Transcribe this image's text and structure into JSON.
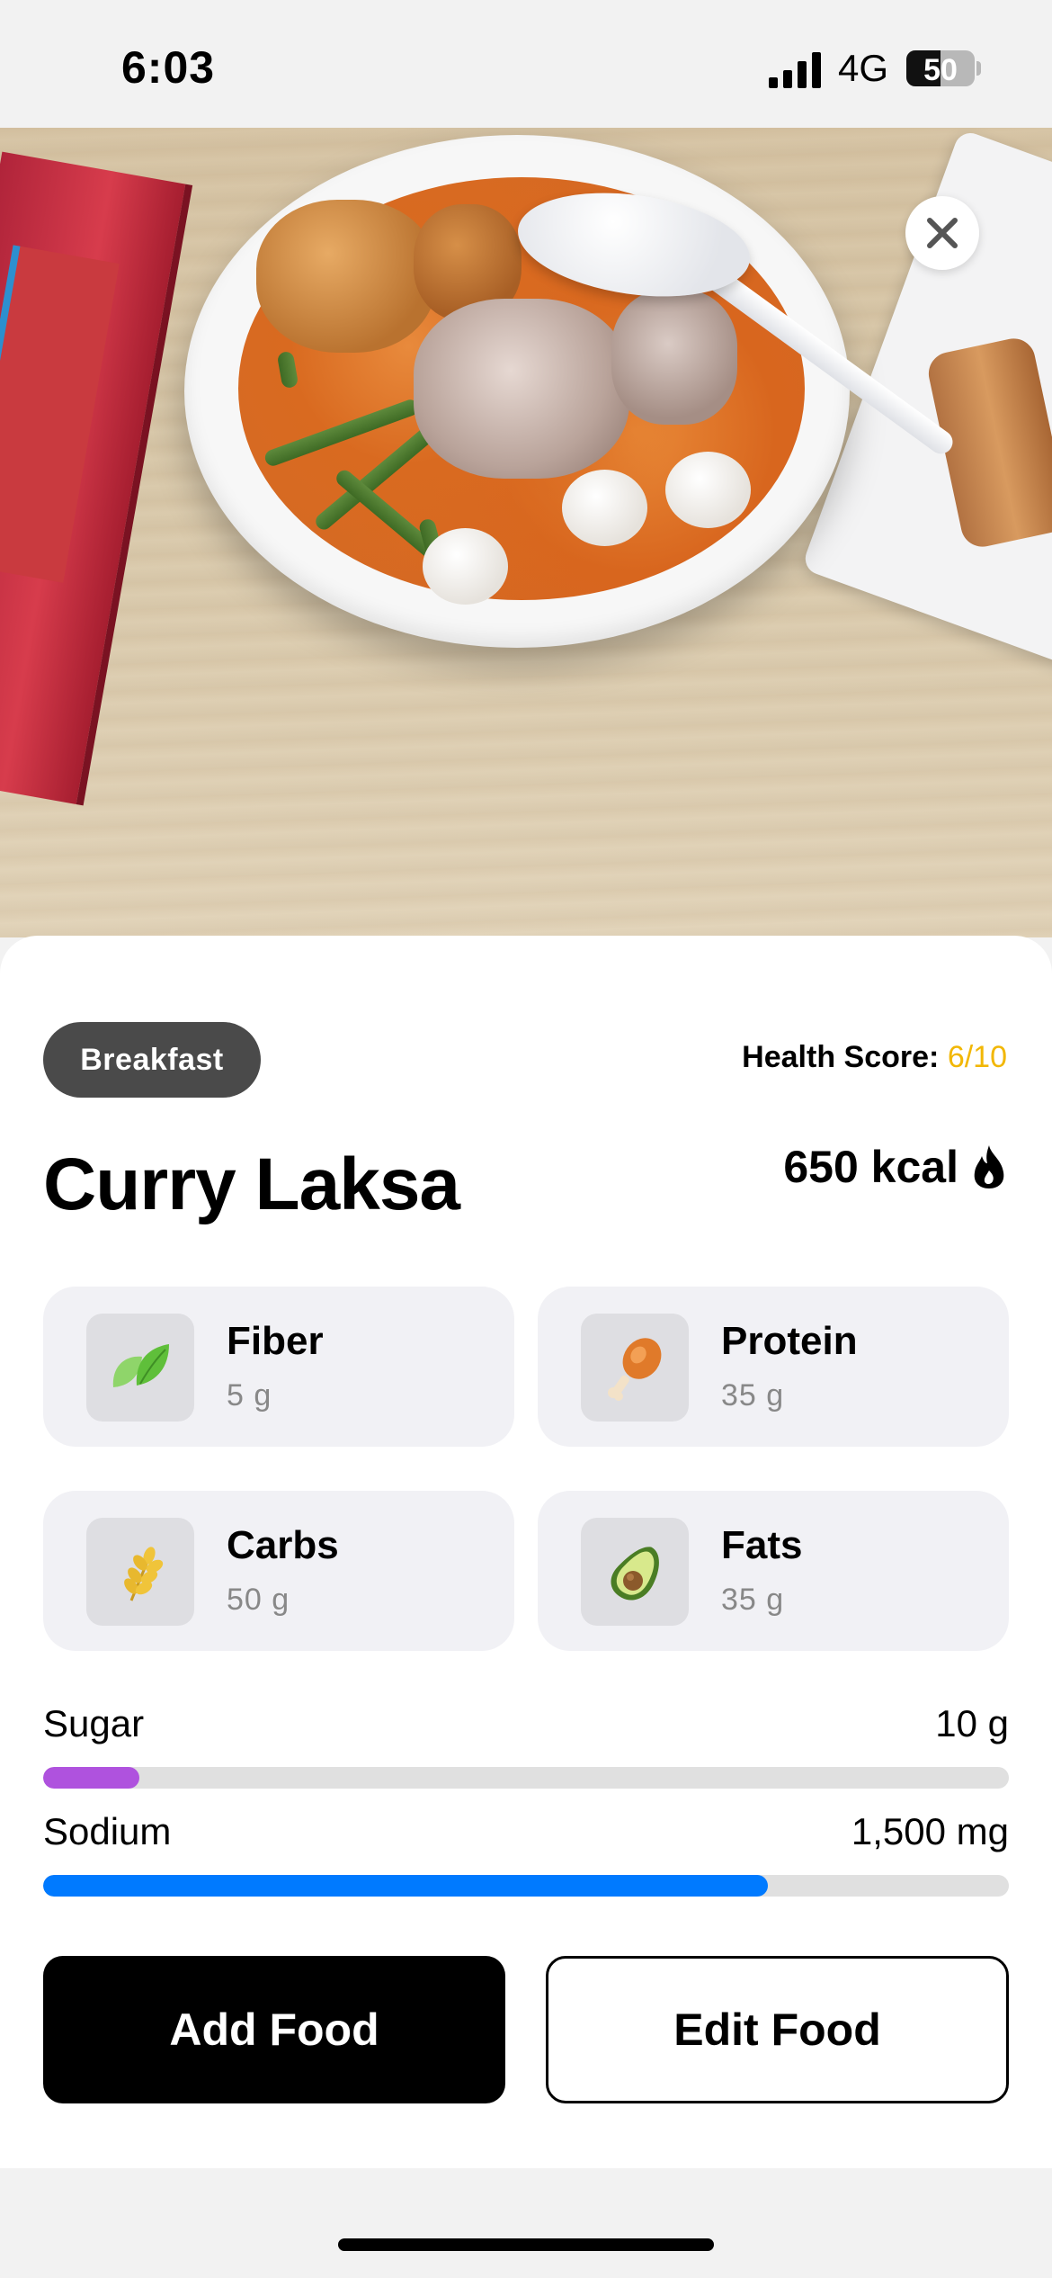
{
  "status_bar": {
    "time": "6:03",
    "network": "4G",
    "battery": "50"
  },
  "hero": {
    "image_description": "bowl of curry laksa",
    "close_icon": "close-icon"
  },
  "meal": {
    "category": "Breakfast",
    "health_score_label": "Health Score:",
    "health_score_value": "6/10",
    "name": "Curry Laksa",
    "calories": "650 kcal"
  },
  "macros": [
    {
      "name": "Fiber",
      "value": "5 g",
      "icon": "leaf-icon"
    },
    {
      "name": "Protein",
      "value": "35 g",
      "icon": "drumstick-icon"
    },
    {
      "name": "Carbs",
      "value": "50 g",
      "icon": "wheat-icon"
    },
    {
      "name": "Fats",
      "value": "35 g",
      "icon": "avocado-icon"
    }
  ],
  "nutrients": [
    {
      "name": "Sugar",
      "value": "10 g",
      "progress": 0.1,
      "color": "#af52de"
    },
    {
      "name": "Sodium",
      "value": "1,500 mg",
      "progress": 0.75,
      "color": "#007aff"
    }
  ],
  "actions": {
    "add_label": "Add Food",
    "edit_label": "Edit Food"
  },
  "colors": {
    "accent_score": "#f2b705",
    "sugar_bar": "#af52de",
    "sodium_bar": "#007aff"
  }
}
